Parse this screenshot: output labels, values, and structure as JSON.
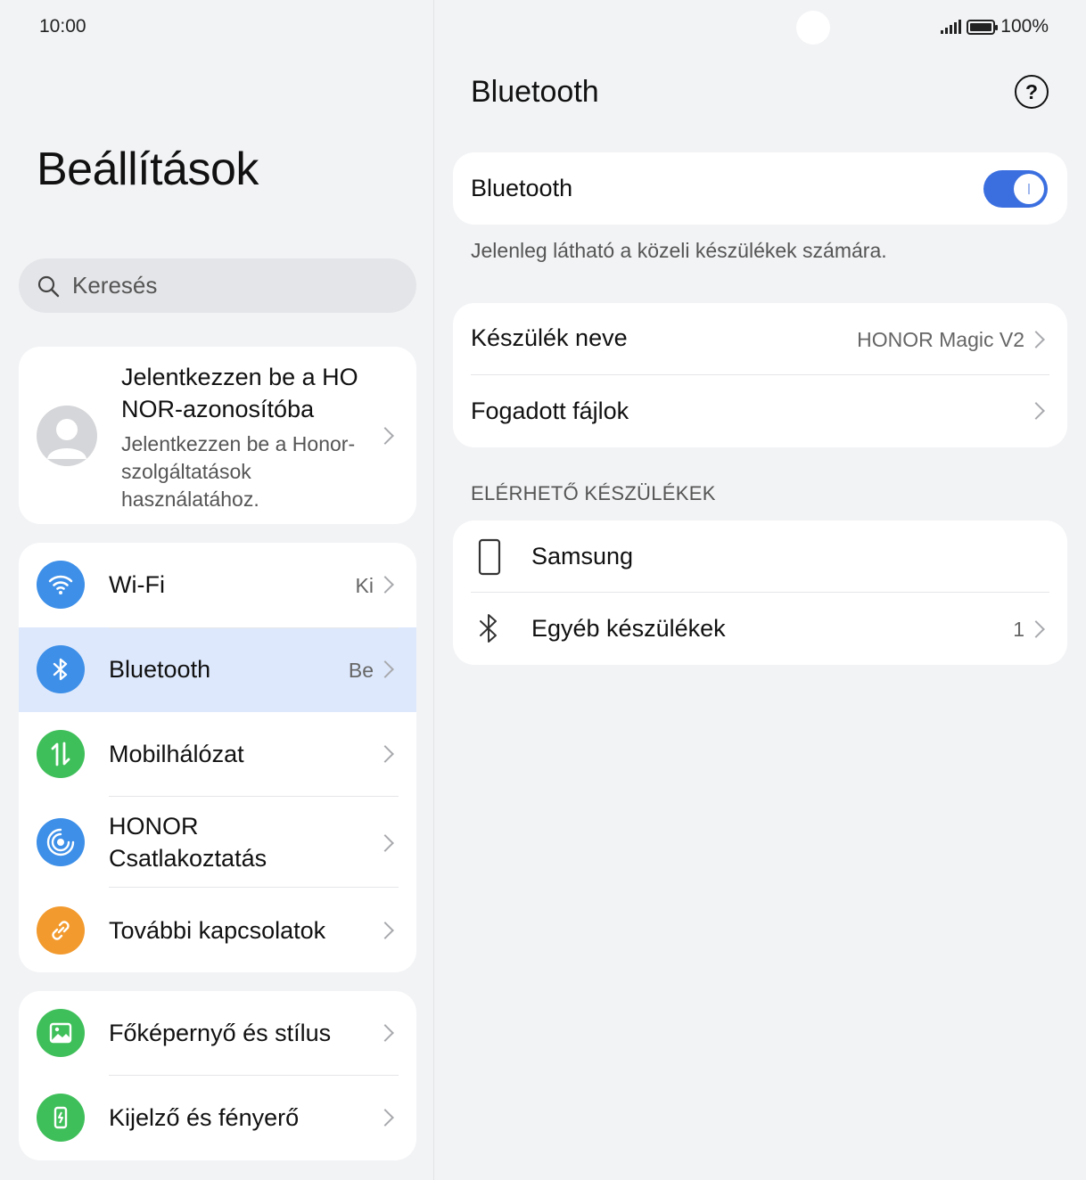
{
  "status_bar": {
    "time": "10:00",
    "battery": "100%"
  },
  "settings": {
    "title": "Beállítások",
    "search_placeholder": "Keresés",
    "account": {
      "title": "Jelentkezzen be a HONOR-azonosítóba",
      "subtitle": "Jelentkezzen be a Honor-szolgáltatások használatához."
    },
    "items": [
      {
        "label": "Wi-Fi",
        "value": "Ki",
        "icon": "wifi-icon",
        "color": "#3d8fe8"
      },
      {
        "label": "Bluetooth",
        "value": "Be",
        "icon": "bluetooth-icon",
        "color": "#3d8fe8"
      },
      {
        "label": "Mobilhálózat",
        "value": "",
        "icon": "mobile-data-icon",
        "color": "#3fbf5a"
      },
      {
        "label": "HONOR Csatlakoztatás",
        "value": "",
        "icon": "honor-connect-icon",
        "color": "#3d8fe8"
      },
      {
        "label": "További kapcsolatok",
        "value": "",
        "icon": "link-icon",
        "color": "#f29a2e"
      },
      {
        "label": "Főképernyő és stílus",
        "value": "",
        "icon": "wallpaper-icon",
        "color": "#3fbf5a"
      },
      {
        "label": "Kijelző és fényerő",
        "value": "",
        "icon": "display-icon",
        "color": "#3fbf5a"
      }
    ]
  },
  "bluetooth": {
    "title": "Bluetooth",
    "toggle_label": "Bluetooth",
    "toggle_on": true,
    "visibility_note": "Jelenleg látható a közeli készülékek számára.",
    "device_name_label": "Készülék neve",
    "device_name_value": "HONOR Magic V2",
    "received_files_label": "Fogadott fájlok",
    "available_header": "ELÉRHETŐ KÉSZÜLÉKEK",
    "available": [
      {
        "name": "Samsung",
        "icon": "phone-icon",
        "count": ""
      },
      {
        "name": "Egyéb készülékek",
        "icon": "bluetooth-icon",
        "count": "1"
      }
    ],
    "accent": "#3b6fe0"
  }
}
